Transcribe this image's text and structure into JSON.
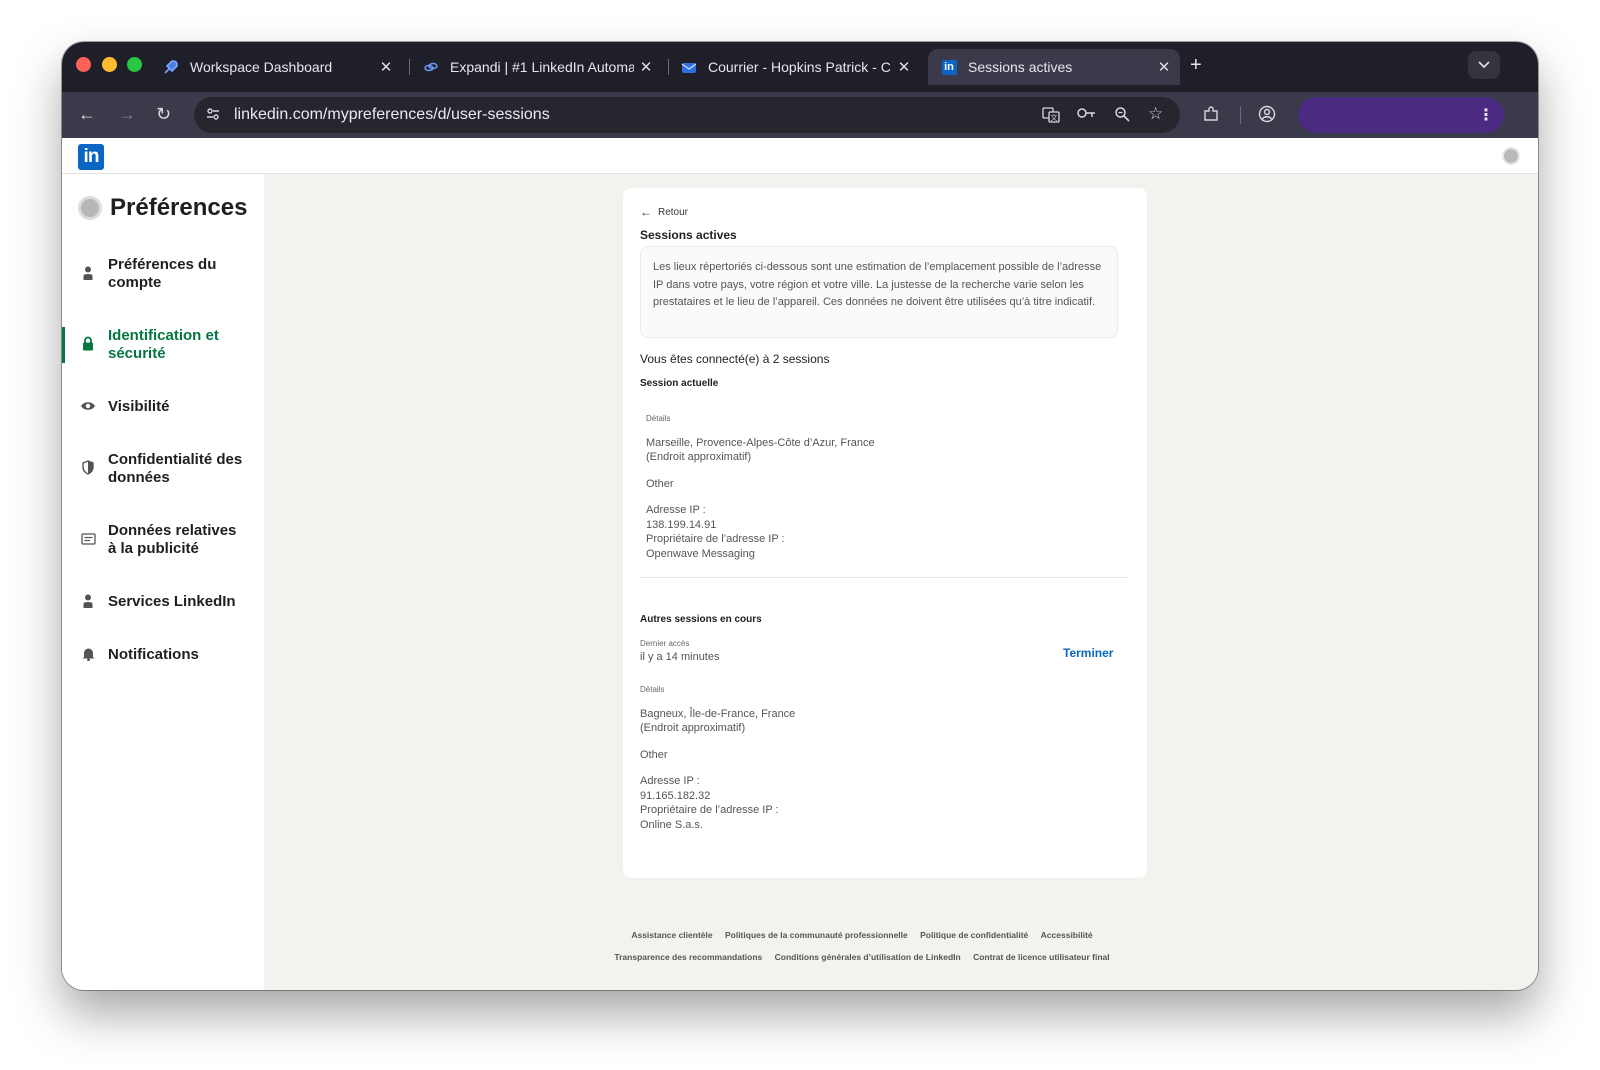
{
  "browser": {
    "tabs": [
      {
        "title": "Workspace Dashboard",
        "icon": "rocket-icon"
      },
      {
        "title": "Expandi | #1 LinkedIn Automa",
        "icon": "link-icon"
      },
      {
        "title": "Courrier - Hopkins Patrick - C",
        "icon": "mail-icon"
      },
      {
        "title": "Sessions actives",
        "icon": "linkedin-icon",
        "active": true
      }
    ],
    "new_tab": "+",
    "tab_menu": "⌄",
    "url": "linkedin.com/mypreferences/d/user-sessions"
  },
  "header": {
    "logo": "in"
  },
  "sidebar": {
    "title": "Préférences",
    "items": [
      {
        "label": "Préférences du compte",
        "icon": "person-icon"
      },
      {
        "label": "Identification et sécurité",
        "icon": "lock-icon",
        "active": true
      },
      {
        "label": "Visibilité",
        "icon": "eye-icon"
      },
      {
        "label": "Confidentialité des données",
        "icon": "shield-icon"
      },
      {
        "label": "Données relatives à la publicité",
        "icon": "ad-icon"
      },
      {
        "label": "Services LinkedIn",
        "icon": "person-icon"
      },
      {
        "label": "Notifications",
        "icon": "bell-icon"
      }
    ]
  },
  "main": {
    "back_label": "Retour",
    "title": "Sessions actives",
    "info_text": "Les lieux répertoriés ci-dessous sont une estimation de l’emplacement possible de l’adresse IP dans votre pays, votre région et votre ville. La justesse de la recherche varie selon les prestataires et le lieu de l’appareil. Ces données ne doivent être utilisées qu’à titre indicatif.",
    "connected_text": "Vous êtes connecté(e) à 2 sessions",
    "current_session": {
      "heading": "Session actuelle",
      "details_label": "Détails",
      "location": "Marseille, Provence-Alpes-Côte d’Azur, France",
      "approx": "(Endroit approximatif)",
      "device": "Other",
      "ip_label": "Adresse IP :",
      "ip": "138.199.14.91",
      "owner_label": "Propriétaire de l’adresse IP :",
      "owner": "Openwave Messaging"
    },
    "other_sessions": {
      "heading": "Autres sessions en cours",
      "last_access_label": "Dernier accès",
      "last_access": "il y a 14 minutes",
      "terminate_label": "Terminer",
      "details_label": "Détails",
      "location": "Bagneux, Île-de-France, France",
      "approx": "(Endroit approximatif)",
      "device": "Other",
      "ip_label": "Adresse IP :",
      "ip": "91.165.182.32",
      "owner_label": "Propriétaire de l’adresse IP :",
      "owner": "Online S.a.s."
    }
  },
  "footer": {
    "row1": [
      "Assistance clientèle",
      "Politiques de la communauté professionnelle",
      "Politique de confidentialité",
      "Accessibilité"
    ],
    "row2": [
      "Transparence des recommandations",
      "Conditions générales d’utilisation de LinkedIn",
      "Contrat de licence utilisateur final"
    ]
  },
  "colors": {
    "linkedin_blue": "#0a66c2",
    "active_green": "#057642",
    "profile_purple": "#4b2a82"
  }
}
